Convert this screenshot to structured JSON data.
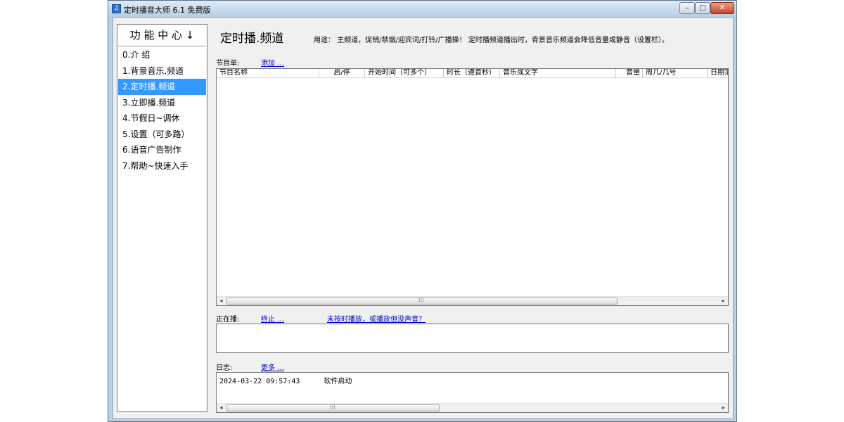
{
  "window": {
    "title": "定时播音大师 6.1 免费版",
    "min_label": "–",
    "max_label": "□",
    "close_label": "✕"
  },
  "sidebar": {
    "header": "功 能 中 心 ↓",
    "items": [
      {
        "label": "0.介 绍"
      },
      {
        "label": "1.背景音乐.频道"
      },
      {
        "label": "2.定时播.频道",
        "selected": true
      },
      {
        "label": "3.立即播.频道"
      },
      {
        "label": "4.节假日~调休"
      },
      {
        "label": "5.设置（可多路）"
      },
      {
        "label": "6.语音广告制作"
      },
      {
        "label": "7.帮助~快速入手"
      }
    ]
  },
  "main": {
    "title": "定时播.频道",
    "usage": "用途：  主频道，促销/禁烟/迎宾词/打铃/广播操！  定时播频道播出时，背景音乐频道会降低音量或静音（设置栏）。",
    "program": {
      "label": "节目单:",
      "add_link": "添加 …",
      "columns": [
        "节目名称",
        "启/停",
        "开始时间（可多个）",
        "时长（遵首秒）",
        "音乐或文字",
        "音量",
        "周几/几号",
        "日期范"
      ],
      "rows": []
    },
    "playing": {
      "label": "正在播:",
      "stop_link": "终止 …",
      "help_link": "未按时播放，或播放但没声音？"
    },
    "log": {
      "label": "日志:",
      "more_link": "更多 …",
      "entries": [
        {
          "time": "2024-03-22 09:57:43",
          "message": "软件启动"
        }
      ]
    },
    "scroll": {
      "left": "◂",
      "right": "▸",
      "grip": "⁞⁞⁞"
    }
  }
}
